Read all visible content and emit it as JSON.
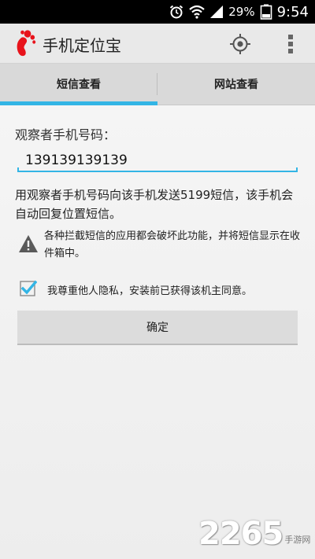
{
  "status_bar": {
    "battery_percent": "29%",
    "time": "9:54",
    "icons": [
      "alarm-icon",
      "wifi-icon",
      "signal-icon",
      "battery-icon"
    ]
  },
  "action_bar": {
    "title": "手机定位宝",
    "logo_icon": "footprint-icon",
    "locate_icon": "crosshair-icon",
    "overflow_icon": "overflow-menu-icon"
  },
  "tabs": [
    {
      "label": "短信查看",
      "selected": true
    },
    {
      "label": "网站查看",
      "selected": false
    }
  ],
  "form": {
    "observer_label": "观察者手机号码：",
    "phone_value": "139139139139",
    "instruction": "用观察者手机号码向该手机发送5199短信，该手机会自动回复位置短信。",
    "warning": "各种拦截短信的应用都会破坏此功能，并将短信显示在收件箱中。",
    "consent_label": "我尊重他人隐私，安装前已获得该机主同意。",
    "consent_checked": true,
    "confirm_label": "确定"
  },
  "watermark": {
    "number": "2265",
    "sub": "手游网"
  },
  "colors": {
    "accent": "#33b5e5",
    "logo": "#e8131b",
    "status_bar": "#000000"
  }
}
